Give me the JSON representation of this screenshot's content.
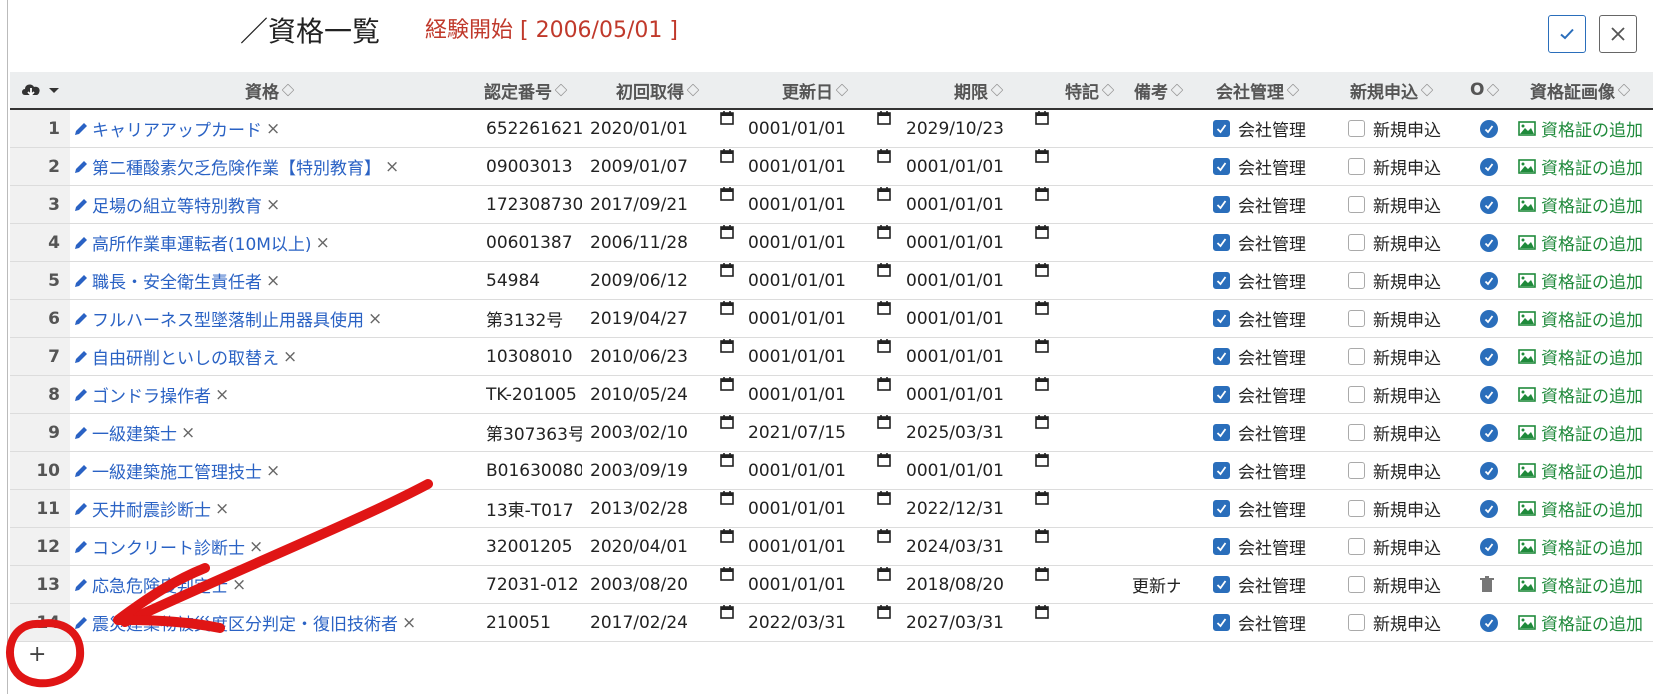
{
  "header": {
    "title": "／資格一覧",
    "experience_start": "経験開始 [ 2006/05/01 ]"
  },
  "columns": {
    "download_icon": "cloud-download-icon",
    "name": "資格",
    "cert_no": "認定番号",
    "first_acquired": "初回取得",
    "renewal": "更新日",
    "expiry": "期限",
    "special": "特記",
    "remarks": "備考",
    "company_mgmt": "会社管理",
    "new_app": "新規申込",
    "circle": "O",
    "image": "資格証画像"
  },
  "rows": [
    {
      "n": "1",
      "name": "キャリアアップカード",
      "cert": "652261621",
      "first": "2020/01/01",
      "renew": "0001/01/01",
      "expire": "2029/10/23",
      "remark": "",
      "company": "会社管理",
      "newapp": "新規申込",
      "status": "check",
      "image": "資格証の追加"
    },
    {
      "n": "2",
      "name": "第二種酸素欠乏危険作業【特別教育】",
      "cert": "09003013",
      "first": "2009/01/07",
      "renew": "0001/01/01",
      "expire": "0001/01/01",
      "remark": "",
      "company": "会社管理",
      "newapp": "新規申込",
      "status": "check",
      "image": "資格証の追加"
    },
    {
      "n": "3",
      "name": "足場の組立等特別教育",
      "cert": "172308730",
      "first": "2017/09/21",
      "renew": "0001/01/01",
      "expire": "0001/01/01",
      "remark": "",
      "company": "会社管理",
      "newapp": "新規申込",
      "status": "check",
      "image": "資格証の追加"
    },
    {
      "n": "4",
      "name": "高所作業車運転者(10M以上)",
      "cert": "00601387",
      "first": "2006/11/28",
      "renew": "0001/01/01",
      "expire": "0001/01/01",
      "remark": "",
      "company": "会社管理",
      "newapp": "新規申込",
      "status": "check",
      "image": "資格証の追加"
    },
    {
      "n": "5",
      "name": "職長・安全衛生責任者",
      "cert": "54984",
      "first": "2009/06/12",
      "renew": "0001/01/01",
      "expire": "0001/01/01",
      "remark": "",
      "company": "会社管理",
      "newapp": "新規申込",
      "status": "check",
      "image": "資格証の追加"
    },
    {
      "n": "6",
      "name": "フルハーネス型墜落制止用器具使用",
      "cert": "第3132号",
      "first": "2019/04/27",
      "renew": "0001/01/01",
      "expire": "0001/01/01",
      "remark": "",
      "company": "会社管理",
      "newapp": "新規申込",
      "status": "check",
      "image": "資格証の追加"
    },
    {
      "n": "7",
      "name": "自由研削といしの取替え",
      "cert": "10308010",
      "first": "2010/06/23",
      "renew": "0001/01/01",
      "expire": "0001/01/01",
      "remark": "",
      "company": "会社管理",
      "newapp": "新規申込",
      "status": "check",
      "image": "資格証の追加"
    },
    {
      "n": "8",
      "name": "ゴンドラ操作者",
      "cert": "TK-201005",
      "first": "2010/05/24",
      "renew": "0001/01/01",
      "expire": "0001/01/01",
      "remark": "",
      "company": "会社管理",
      "newapp": "新規申込",
      "status": "check",
      "image": "資格証の追加"
    },
    {
      "n": "9",
      "name": "一級建築士",
      "cert": "第307363号",
      "first": "2003/02/10",
      "renew": "2021/07/15",
      "expire": "2025/03/31",
      "remark": "",
      "company": "会社管理",
      "newapp": "新規申込",
      "status": "check",
      "image": "資格証の追加"
    },
    {
      "n": "10",
      "name": "一級建築施工管理技士",
      "cert": "B01630080",
      "first": "2003/09/19",
      "renew": "0001/01/01",
      "expire": "0001/01/01",
      "remark": "",
      "company": "会社管理",
      "newapp": "新規申込",
      "status": "check",
      "image": "資格証の追加"
    },
    {
      "n": "11",
      "name": "天井耐震診断士",
      "cert": "13東-T017",
      "first": "2013/02/28",
      "renew": "0001/01/01",
      "expire": "2022/12/31",
      "remark": "",
      "company": "会社管理",
      "newapp": "新規申込",
      "status": "check",
      "image": "資格証の追加"
    },
    {
      "n": "12",
      "name": "コンクリート診断士",
      "cert": "32001205",
      "first": "2020/04/01",
      "renew": "0001/01/01",
      "expire": "2024/03/31",
      "remark": "",
      "company": "会社管理",
      "newapp": "新規申込",
      "status": "check",
      "image": "資格証の追加"
    },
    {
      "n": "13",
      "name": "応急危険度判定士",
      "cert": "72031-012",
      "first": "2003/08/20",
      "renew": "0001/01/01",
      "expire": "2018/08/20",
      "remark": "更新ナ",
      "company": "会社管理",
      "newapp": "新規申込",
      "status": "trash",
      "image": "資格証の追加"
    },
    {
      "n": "14",
      "name": "震災建築物被災度区分判定・復旧技術者",
      "cert": "210051",
      "first": "2017/02/24",
      "renew": "2022/03/31",
      "expire": "2027/03/31",
      "remark": "",
      "company": "会社管理",
      "newapp": "新規申込",
      "status": "check",
      "image": "資格証の追加"
    }
  ],
  "footer": {
    "add_label": "+"
  },
  "colors": {
    "link": "#2a62c4",
    "accent": "#2a6ebb",
    "red": "#c0392b",
    "green": "#1f8a3b",
    "annotation": "#e01515"
  }
}
